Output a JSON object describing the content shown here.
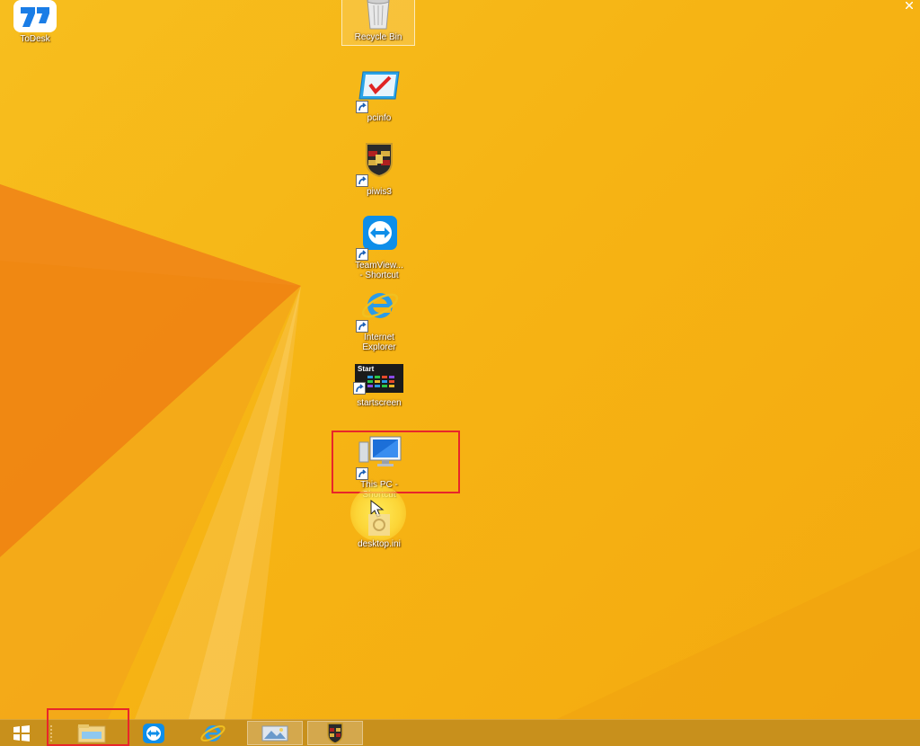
{
  "desktop": {
    "icons": [
      {
        "name": "todesk",
        "label": "ToDesk"
      },
      {
        "name": "recycle-bin",
        "label": "Recycle Bin"
      },
      {
        "name": "pcinfo",
        "label": "pcinfo"
      },
      {
        "name": "piwis3",
        "label": "piwis3"
      },
      {
        "name": "teamviewer",
        "label": "TeamView...\n- Shortcut"
      },
      {
        "name": "internet-explorer",
        "label": "Internet\nExplorer"
      },
      {
        "name": "startscreen",
        "label": "startscreen",
        "tile_text": "Start"
      },
      {
        "name": "this-pc",
        "label": "This PC -\nShortcut"
      },
      {
        "name": "desktop-ini",
        "label": "desktop.ini"
      }
    ]
  },
  "taskbar": {
    "items": [
      {
        "name": "start",
        "icon": "windows-logo-icon"
      },
      {
        "name": "file-explorer",
        "icon": "folder-icon"
      },
      {
        "name": "teamviewer",
        "icon": "teamviewer-icon"
      },
      {
        "name": "internet-explorer",
        "icon": "ie-icon"
      },
      {
        "name": "photos",
        "icon": "photo-viewer-icon"
      },
      {
        "name": "piwis",
        "icon": "porsche-crest-icon"
      }
    ]
  },
  "colors": {
    "wallpaper": "#f6b414",
    "wallpaper_shape": "#ef7f12",
    "taskbar": "#c8901c",
    "highlight": "#e8262a"
  }
}
